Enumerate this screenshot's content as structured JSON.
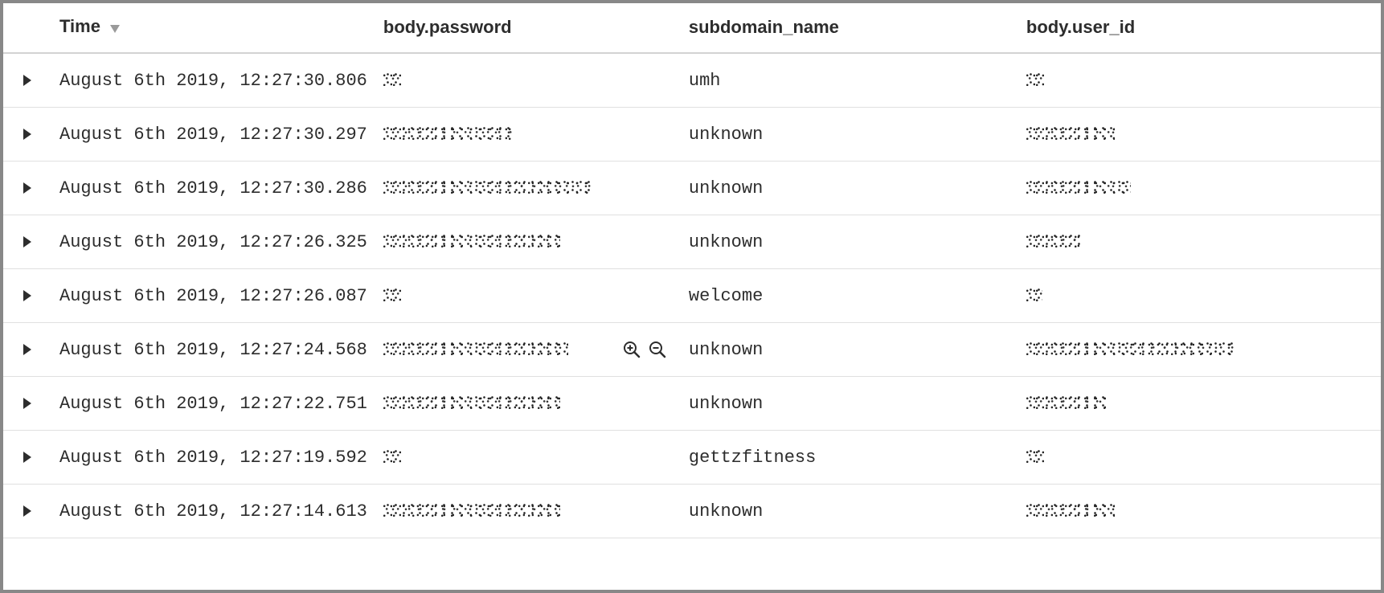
{
  "columns": {
    "time": "Time",
    "password": "body.password",
    "subdomain": "subdomain_name",
    "user_id": "body.user_id"
  },
  "sort": {
    "column": "time",
    "direction": "desc"
  },
  "hover_row_index": 5,
  "rows": [
    {
      "time": "August 6th 2019, 12:27:30.806",
      "password_redacted_width": 24,
      "subdomain": "umh",
      "user_id_redacted_width": 22
    },
    {
      "time": "August 6th 2019, 12:27:30.297",
      "password_redacted_width": 160,
      "subdomain": "unknown",
      "user_id_redacted_width": 110
    },
    {
      "time": "August 6th 2019, 12:27:30.286",
      "password_redacted_width": 260,
      "subdomain": "unknown",
      "user_id_redacted_width": 130
    },
    {
      "time": "August 6th 2019, 12:27:26.325",
      "password_redacted_width": 220,
      "subdomain": "unknown",
      "user_id_redacted_width": 70
    },
    {
      "time": "August 6th 2019, 12:27:26.087",
      "password_redacted_width": 22,
      "subdomain": "welcome",
      "user_id_redacted_width": 20
    },
    {
      "time": "August 6th 2019, 12:27:24.568",
      "password_redacted_width": 230,
      "subdomain": "unknown",
      "user_id_redacted_width": 260
    },
    {
      "time": "August 6th 2019, 12:27:22.751",
      "password_redacted_width": 220,
      "subdomain": "unknown",
      "user_id_redacted_width": 100
    },
    {
      "time": "August 6th 2019, 12:27:19.592",
      "password_redacted_width": 24,
      "subdomain": "gettzfitness",
      "user_id_redacted_width": 22
    },
    {
      "time": "August 6th 2019, 12:27:14.613",
      "password_redacted_width": 220,
      "subdomain": "unknown",
      "user_id_redacted_width": 110
    }
  ]
}
